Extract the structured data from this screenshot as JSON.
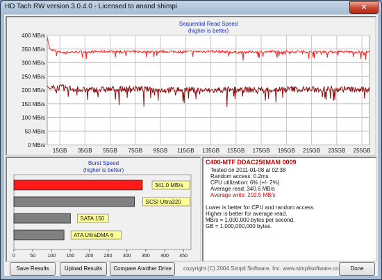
{
  "window": {
    "title": "HD Tach RW version 3.0.4.0 - Licensed to anand shimpi",
    "close_glyph": "✕"
  },
  "chart_data": [
    {
      "type": "line",
      "title": "Sequential Read Speed",
      "subtitle": "(higher is better)",
      "y_ticks": [
        "400 MB/s",
        "350 MB/s",
        "300 MB/s",
        "250 MB/s",
        "200 MB/s",
        "150 MB/s",
        "100 MB/s",
        "50 MB/s",
        "0 MB/s"
      ],
      "x_ticks": [
        "15GB",
        "35GB",
        "55GB",
        "75GB",
        "95GB",
        "115GB",
        "135GB",
        "155GB",
        "175GB",
        "195GB",
        "215GB",
        "235GB",
        "255GB"
      ],
      "ylim": [
        0,
        400
      ],
      "xlim": [
        5,
        261
      ],
      "grid": true,
      "series": [
        {
          "color": "#ff2020",
          "x": [
            5,
            7,
            15,
            35,
            55,
            75,
            95,
            115,
            135,
            155,
            175,
            195,
            215,
            235,
            255,
            261
          ],
          "values": [
            392,
            350,
            338,
            340,
            341,
            340,
            341,
            340,
            342,
            338,
            340,
            341,
            340,
            340,
            339,
            338
          ]
        },
        {
          "color": "#8b0f0f",
          "x": [
            5,
            7,
            15,
            35,
            55,
            75,
            95,
            115,
            135,
            155,
            175,
            195,
            215,
            235,
            255,
            261
          ],
          "values": [
            215,
            205,
            210,
            200,
            203,
            205,
            200,
            202,
            198,
            203,
            200,
            204,
            202,
            205,
            200,
            203
          ]
        }
      ]
    },
    {
      "type": "bar",
      "title": "Burst Speed",
      "subtitle": "(higher is better)",
      "categories": [
        "341.0 MB/s",
        "SCSI Ultra320",
        "SATA 150",
        "ATA UltraDMA 6"
      ],
      "values": [
        341,
        320,
        150,
        133
      ],
      "bar_colors": [
        "#ff1a1a",
        "#808080",
        "#808080",
        "#808080"
      ],
      "xlim": [
        0,
        470
      ],
      "x_ticks": [
        "0",
        "50",
        "100",
        "150",
        "200",
        "250",
        "300",
        "350",
        "400",
        "450"
      ]
    }
  ],
  "info": {
    "drive": "C400-MTF DDAC256MAM 0009",
    "tested": "Tested on 2011-01-08 at 02:38",
    "random_access": "Random access: 0.2ms",
    "cpu": "CPU utilization: 6% (+/- 2%)",
    "avg_read": "Average read: 340.6 MB/s",
    "avg_write": "Average write: 202.5 MB/s",
    "note1": "Lower is better for CPU and random access.",
    "note2": "Higher is better for average read.",
    "note3": "MB/s = 1,000,000 bytes per second.",
    "note4": "GB = 1,000,000,000 bytes."
  },
  "buttons": {
    "save": "Save Results",
    "upload": "Upload Results",
    "compare": "Compare Another Drive",
    "done": "Done"
  },
  "copyright": "copyright (C) 2004 Simpli Software, Inc. www.simplisoftware.com",
  "colors": {
    "drive_title": "#cc0000",
    "avg_write": "#cc0000",
    "seq_title": "#1d2fb5"
  }
}
